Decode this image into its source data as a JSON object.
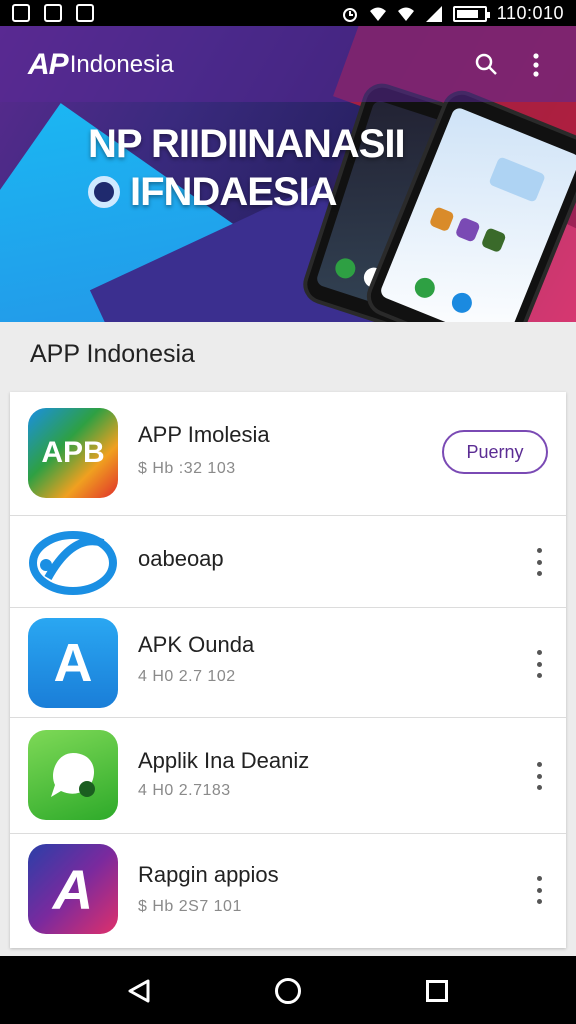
{
  "status_bar": {
    "time": "110:010"
  },
  "app_bar": {
    "logo_mark": "AP",
    "logo_text": "Indonesia",
    "search_icon": "search-icon",
    "more_icon": "more-vert-icon"
  },
  "hero": {
    "line1": "NP RIIDIINANASII",
    "line2": "IFNDAESIA"
  },
  "section": {
    "title": "APP Indonesia"
  },
  "apps": [
    {
      "name": "APP Imolesia",
      "meta": "$ Hb :32 103",
      "icon_text": "APB",
      "action": "Puerny"
    },
    {
      "name": "oabeoap",
      "meta": "",
      "icon_text": ""
    },
    {
      "name": "APK Ounda",
      "meta": "4 H0 2.7 102",
      "icon_text": "A"
    },
    {
      "name": "Applik Ina Deaniz",
      "meta": "4 H0 2.7183",
      "icon_text": ""
    },
    {
      "name": "Rapgin appios",
      "meta": "$ Hb 2S7 101",
      "icon_text": "A"
    }
  ],
  "colors": {
    "accent": "#5b2c93",
    "hero_blue": "#1bb6f2",
    "hero_red": "#c0245a"
  }
}
